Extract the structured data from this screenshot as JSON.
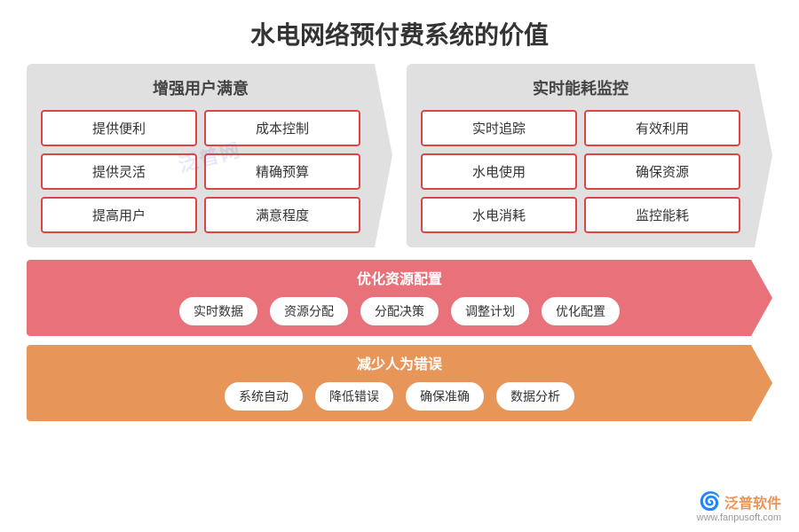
{
  "title": "水电网络预付费系统的价值",
  "watermark": "泛普网",
  "topLeft": {
    "header": "增强用户满意",
    "items": [
      "提供便利",
      "成本控制",
      "提供灵活",
      "精确预算",
      "提高用户",
      "满意程度"
    ]
  },
  "topRight": {
    "header": "实时能耗监控",
    "items": [
      "实时追踪",
      "有效利用",
      "水电使用",
      "确保资源",
      "水电消耗",
      "监控能耗"
    ]
  },
  "bannerPink": {
    "label": "优化资源配置",
    "items": [
      "实时数据",
      "资源分配",
      "分配决策",
      "调整计划",
      "优化配置"
    ]
  },
  "bannerOrange": {
    "label": "减少人为错误",
    "items": [
      "系统自动",
      "降低错误",
      "确保准确",
      "数据分析"
    ]
  },
  "logo": {
    "icon": "泛",
    "company": "普软件",
    "url": "www.fanpusoft.com"
  }
}
